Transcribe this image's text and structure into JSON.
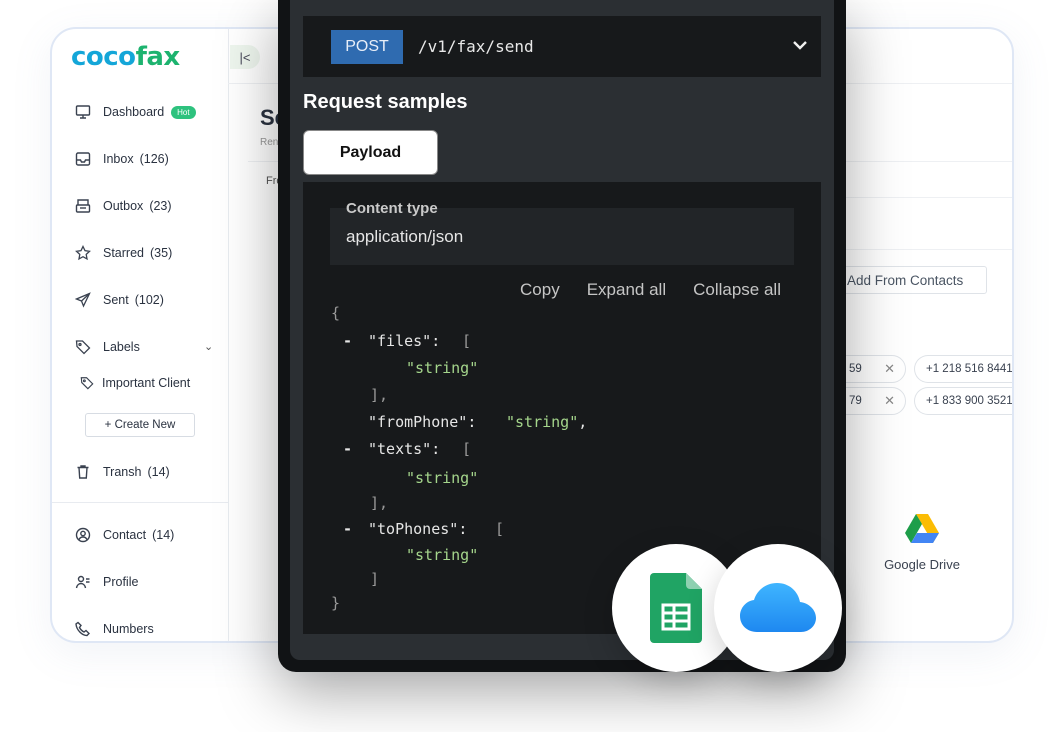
{
  "brand": {
    "logo_main": "coco",
    "logo_accent": "fax"
  },
  "sidebar": {
    "collapse_icon": "chevron-left-bar-icon",
    "items": [
      {
        "label": "Dashboard",
        "count": "",
        "badge": "Hot",
        "icon": "monitor-icon"
      },
      {
        "label": "Inbox",
        "count": "(126)",
        "icon": "inbox-icon"
      },
      {
        "label": "Outbox",
        "count": "(23)",
        "icon": "outbox-icon"
      },
      {
        "label": "Starred",
        "count": "(35)",
        "icon": "star-icon"
      },
      {
        "label": "Sent",
        "count": "(102)",
        "icon": "send-icon"
      },
      {
        "label": "Labels",
        "count": "",
        "icon": "tag-icon"
      },
      {
        "label": "Transh",
        "count": "(14)",
        "icon": "trash-icon"
      },
      {
        "label": "Contact",
        "count": "(14)",
        "icon": "contact-icon"
      },
      {
        "label": "Profile",
        "count": "",
        "icon": "profile-icon"
      },
      {
        "label": "Numbers",
        "count": "",
        "icon": "phone-icon"
      }
    ],
    "label_item": "Important Client",
    "create_new": "+ Create New"
  },
  "main": {
    "title": "Se",
    "subtitle": "Ren",
    "tab_partial": "Fro",
    "add_contacts": "Add From Contacts",
    "chips": [
      {
        "left": "59",
        "right": "+1 218 516 8441"
      },
      {
        "left": "79",
        "right": "+1 833 900 3521"
      }
    ],
    "google_drive": "Google Drive"
  },
  "api": {
    "method": "POST",
    "path": "/v1/fax/send",
    "section_title": "Request samples",
    "tab": "Payload",
    "content_type_label": "Content type",
    "content_type_value": "application/json",
    "actions": {
      "copy": "Copy",
      "expand": "Expand all",
      "collapse": "Collapse all"
    },
    "code": {
      "open": "{",
      "files_key": "\"files\"",
      "array_open": "[",
      "string_val": "\"string\"",
      "array_close_comma": "],",
      "array_close": "]",
      "fromphone_key": "\"fromPhone\"",
      "texts_key": "\"texts\"",
      "tophones_key": "\"toPhones\"",
      "close": "}",
      "colon": ":",
      "comma": ",",
      "dash": "-"
    }
  },
  "colors": {
    "brand_blue": "#14a6d8",
    "brand_green": "#1db36f",
    "method_blue": "#2f6bb0",
    "string_green": "#a5d68c"
  }
}
